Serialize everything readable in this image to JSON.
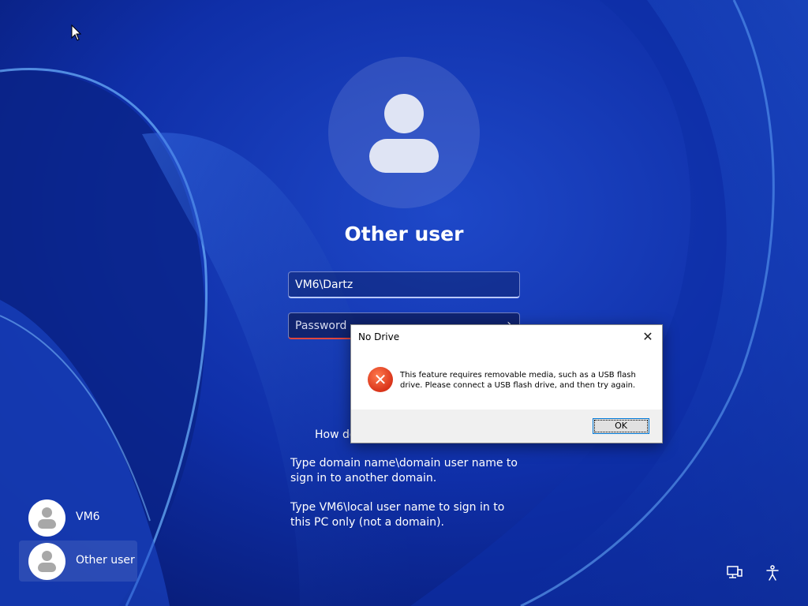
{
  "login": {
    "title": "Other user",
    "username_value": "VM6\\Dartz",
    "password_placeholder": "Password",
    "submit_icon": "arrow-right-icon",
    "help_link": "How do I sign in to another domain?",
    "help_link_visible": "How do",
    "help_text_1": "Type domain name\\domain user name to sign in to another domain.",
    "help_text_2": "Type VM6\\local user name to sign in to this PC only (not a domain)."
  },
  "users": [
    {
      "label": "VM6",
      "selected": false
    },
    {
      "label": "Other user",
      "selected": true
    }
  ],
  "tray": {
    "network_icon": "network-icon",
    "accessibility_icon": "accessibility-icon"
  },
  "dialog": {
    "title": "No Drive",
    "message": "This feature requires removable media, such as a USB flash drive. Please connect a USB flash drive, and then try again.",
    "ok_label": "OK",
    "icon": "error-icon"
  },
  "colors": {
    "background": "#0b2a9a",
    "error_accent": "#e0463c",
    "focus_blue": "#0078d7"
  }
}
